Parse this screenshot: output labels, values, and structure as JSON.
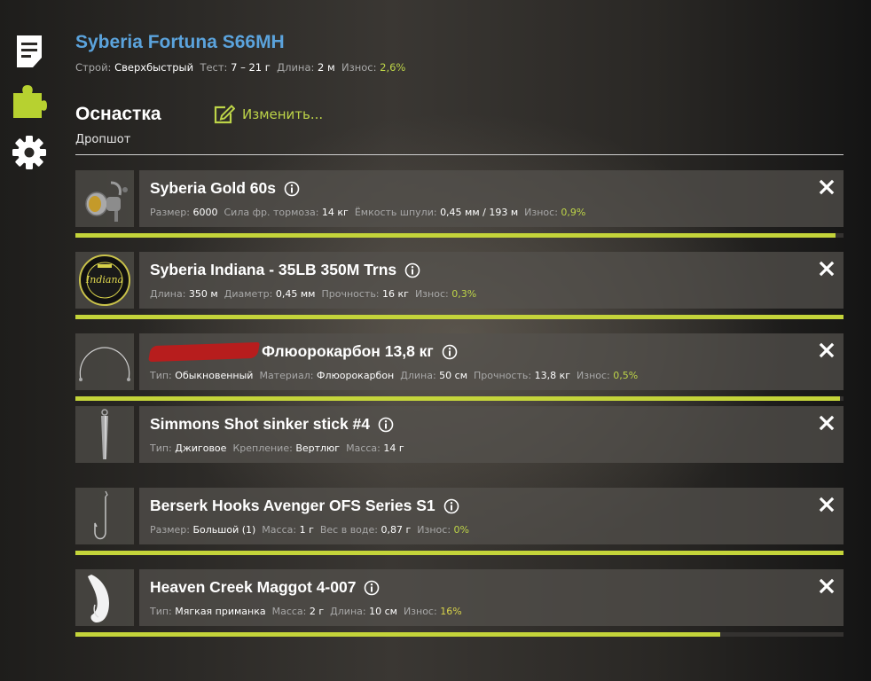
{
  "rod": {
    "name": "Syberia Fortuna S66MH",
    "stats": [
      {
        "label": "Строй:",
        "value": "Сверхбыстрый"
      },
      {
        "label": "Тест:",
        "value": "7 – 21 г"
      },
      {
        "label": "Длина:",
        "value": "2 м"
      }
    ],
    "wear_label": "Износ:",
    "wear_value": "2,6%"
  },
  "section": {
    "title": "Оснастка",
    "edit_label": "Изменить...",
    "rig_type": "Дропшот"
  },
  "items": [
    {
      "name": "Syberia Gold 60s",
      "stats": [
        {
          "label": "Размер:",
          "value": "6000"
        },
        {
          "label": "Сила фр. тормоза:",
          "value": "14 кг"
        },
        {
          "label": "Ёмкость шпули:",
          "value": "0,45 мм / 193 м"
        }
      ],
      "wear_label": "Износ:",
      "wear_value": "0,9%",
      "durability": 0.99
    },
    {
      "name": "Syberia Indiana - 35LB 350M Trns",
      "stats": [
        {
          "label": "Длина:",
          "value": "350 м"
        },
        {
          "label": "Диаметр:",
          "value": "0,45 мм"
        },
        {
          "label": "Прочность:",
          "value": "16 кг"
        }
      ],
      "wear_label": "Износ:",
      "wear_value": "0,3%",
      "durability": 1.0
    },
    {
      "name": "Флюорокарбон 13,8 кг",
      "stats": [
        {
          "label": "Тип:",
          "value": "Обыкновенный"
        },
        {
          "label": "Материал:",
          "value": "Флюорокарбон"
        },
        {
          "label": "Длина:",
          "value": "50 см"
        },
        {
          "label": "Прочность:",
          "value": "13,8 кг"
        }
      ],
      "wear_label": "Износ:",
      "wear_value": "0,5%",
      "durability": 0.995
    },
    {
      "name": "Simmons Shot sinker stick #4",
      "stats": [
        {
          "label": "Тип:",
          "value": "Джиговое"
        },
        {
          "label": "Крепление:",
          "value": "Вертлюг"
        },
        {
          "label": "Масса:",
          "value": "14 г"
        }
      ]
    },
    {
      "name": "Berserk Hooks Avenger OFS Series S1",
      "stats": [
        {
          "label": "Размер:",
          "value": "Большой (1)"
        },
        {
          "label": "Масса:",
          "value": "1 г"
        },
        {
          "label": "Вес в воде:",
          "value": "0,87 г"
        }
      ],
      "wear_label": "Износ:",
      "wear_value": "0%",
      "durability": 1.0
    },
    {
      "name": "Heaven Creek Maggot 4-007",
      "stats": [
        {
          "label": "Тип:",
          "value": "Мягкая приманка"
        },
        {
          "label": "Масса:",
          "value": "2 г"
        },
        {
          "label": "Длина:",
          "value": "10 см"
        }
      ],
      "wear_label": "Износ:",
      "wear_value": "16%",
      "durability": 0.84
    }
  ],
  "icons": {
    "sidebar": [
      "document-icon",
      "puzzle-icon",
      "gear-icon"
    ],
    "item": [
      "info-icon",
      "close-icon"
    ],
    "thumbnails": [
      "reel-icon",
      "line-spool-icon",
      "leader-line-icon",
      "sinker-icon",
      "hook-icon",
      "maggot-lure-icon"
    ]
  },
  "colors": {
    "title_blue": "#5ba3dc",
    "accent_green": "#bdd448",
    "wear_bar": "#c4d43a",
    "wear_warn": "#d8d34a"
  }
}
